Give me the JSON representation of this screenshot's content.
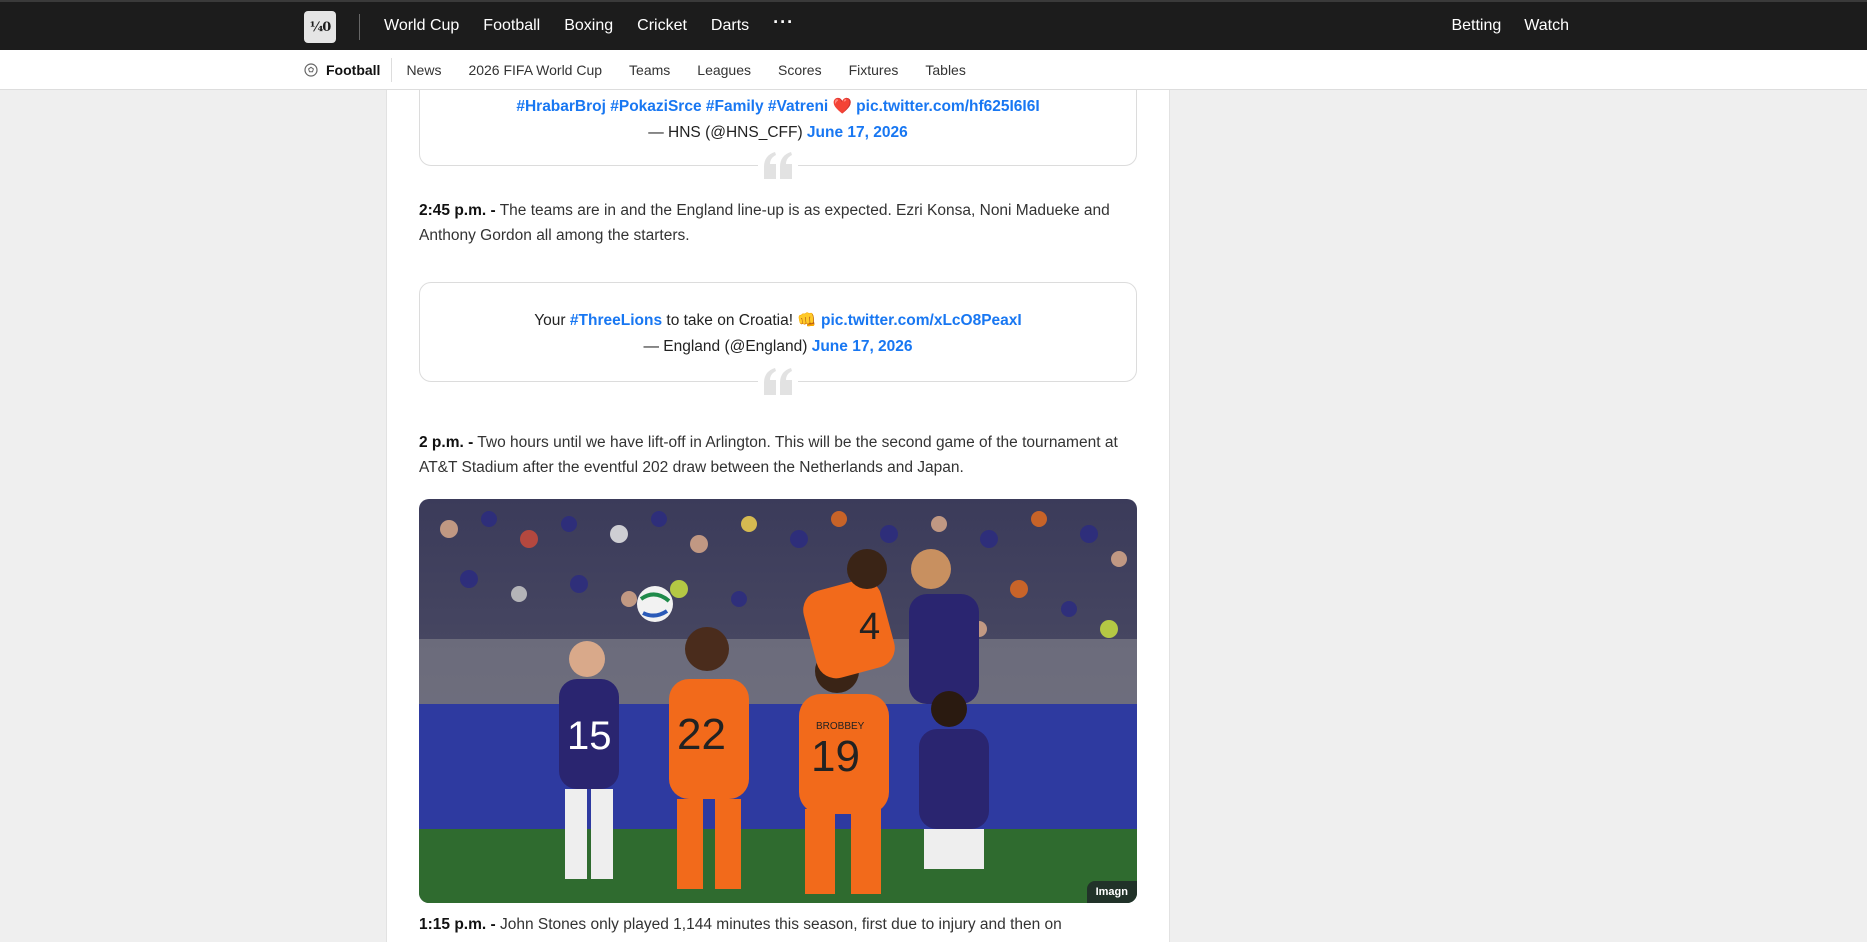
{
  "topnav": {
    "logo_text": "¼0",
    "items": [
      "World Cup",
      "Football",
      "Boxing",
      "Cricket",
      "Darts"
    ],
    "more": "···",
    "right_items": [
      "Betting",
      "Watch"
    ]
  },
  "subnav": {
    "current": "Football",
    "links": [
      "News",
      "2026 FIFA World Cup",
      "Teams",
      "Leagues",
      "Scores",
      "Fixtures",
      "Tables"
    ]
  },
  "tweet1": {
    "hashtags": "#HrabarBroj #PokaziSrce #Family #Vatreni",
    "emoji": "❤️",
    "link": "pic.twitter.com/hf625I6I6I",
    "attribution": "— HNS (@HNS_CFF)",
    "date": "June 17, 2026"
  },
  "update1": {
    "time": "2:45 p.m. -",
    "text": "The teams are in and the England line-up is as expected. Ezri Konsa, Noni Madueke and Anthony Gordon all among the starters."
  },
  "tweet2": {
    "pre": "Your",
    "hashtag": "#ThreeLions",
    "text": "to take on Croatia!",
    "emoji": "👊",
    "link": "pic.twitter.com/xLcO8PeaxI",
    "attribution": "— England (@England)",
    "date": "June 17, 2026"
  },
  "update2": {
    "time": "2 p.m. -",
    "text": "Two hours until we have lift-off in Arlington. This will be the second game of the tournament at AT&T Stadium after the eventful 202 draw between the Netherlands and Japan."
  },
  "photo": {
    "credit": "Imagn",
    "shirts": [
      "15",
      "22",
      "19",
      "4"
    ],
    "name_on_shirt": "BROBBEY"
  },
  "update3": {
    "time": "1:15 p.m. -",
    "text": "John Stones only played 1,144 minutes this season, first due to injury and then on"
  },
  "colors": {
    "topbar": "#1c1c1c",
    "link": "#1877f2",
    "netherlands": "#f26a1b",
    "japan": "#2a2570"
  }
}
